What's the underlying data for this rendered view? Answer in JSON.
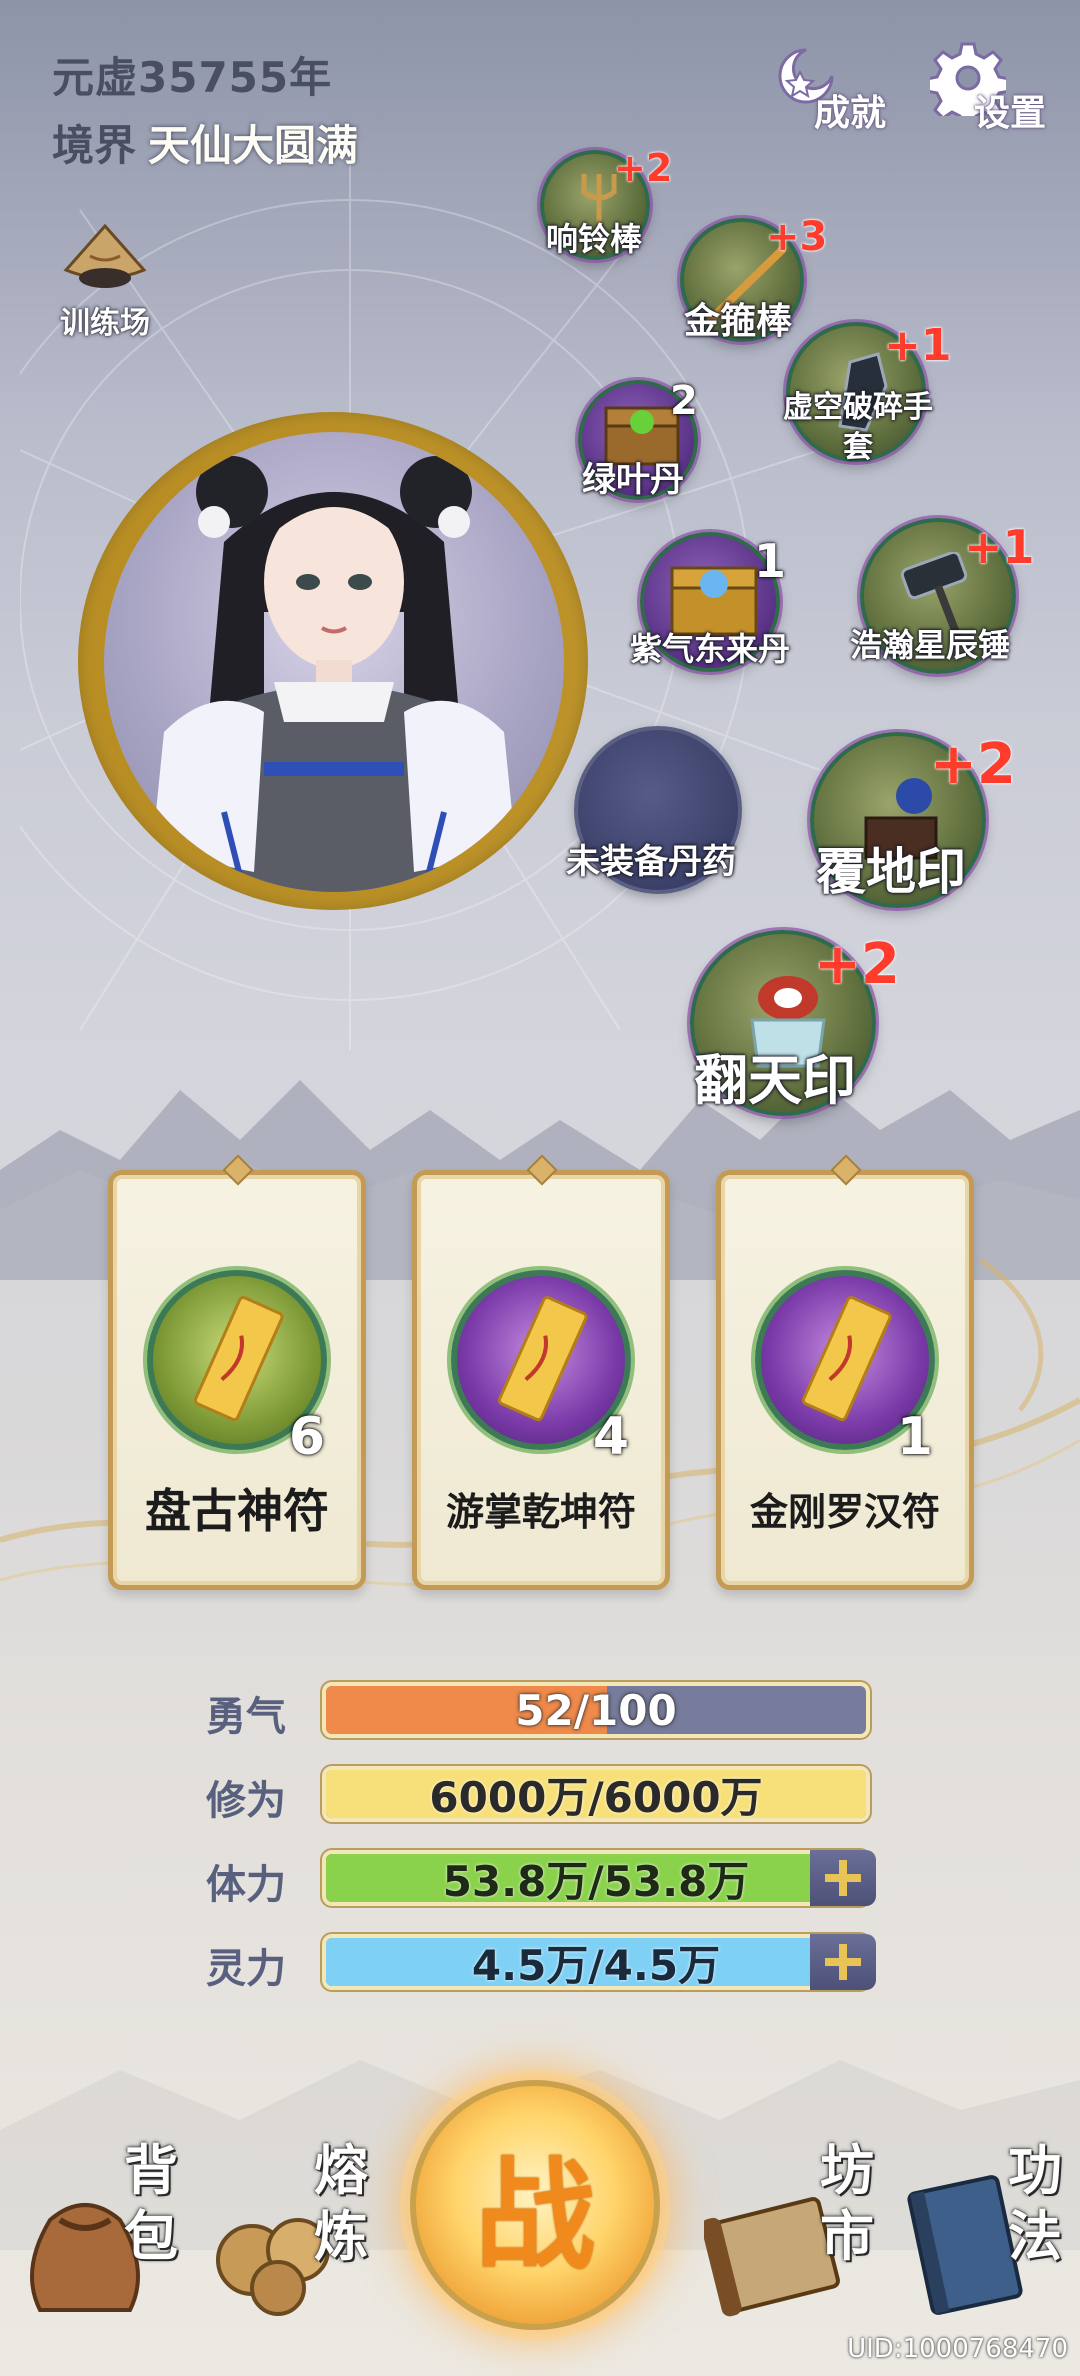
{
  "header": {
    "era": "元虚35755年",
    "realm_label": "境界",
    "realm_value": "天仙大圆满",
    "achievement_label": "成就",
    "settings_label": "设置",
    "training_label": "训练场"
  },
  "equipment": [
    {
      "name": "响铃棒",
      "badge": "+2"
    },
    {
      "name": "金箍棒",
      "badge": "+3"
    },
    {
      "name": "虚空破碎手套",
      "badge": "+1"
    },
    {
      "name": "绿叶丹",
      "badge": "2"
    },
    {
      "name": "紫气东来丹",
      "badge": "1"
    },
    {
      "name": "浩瀚星辰锤",
      "badge": "+1"
    },
    {
      "name": "未装备丹药",
      "badge": ""
    },
    {
      "name": "覆地印",
      "badge": "+2"
    },
    {
      "name": "翻天印",
      "badge": "+2"
    }
  ],
  "talismans": [
    {
      "name": "盘古神符",
      "count": "6"
    },
    {
      "name": "游掌乾坤符",
      "count": "4"
    },
    {
      "name": "金刚罗汉符",
      "count": "1"
    }
  ],
  "stats": [
    {
      "label": "勇气",
      "value": "52/100",
      "fill": 0.52,
      "color": "#f08a4a"
    },
    {
      "label": "修为",
      "value": "6000万/6000万",
      "fill": 1.0,
      "color": "#f7e07a"
    },
    {
      "label": "体力",
      "value": "53.8万/53.8万",
      "fill": 1.0,
      "color": "#8ad14c"
    },
    {
      "label": "灵力",
      "value": "4.5万/4.5万",
      "fill": 1.0,
      "color": "#7fd0f5"
    }
  ],
  "nav": {
    "bag": [
      "背",
      "包"
    ],
    "smelt": [
      "熔",
      "炼"
    ],
    "battle": "战",
    "market": [
      "坊",
      "市"
    ],
    "skills": [
      "功",
      "法"
    ]
  },
  "uid": "UID:1000768470"
}
